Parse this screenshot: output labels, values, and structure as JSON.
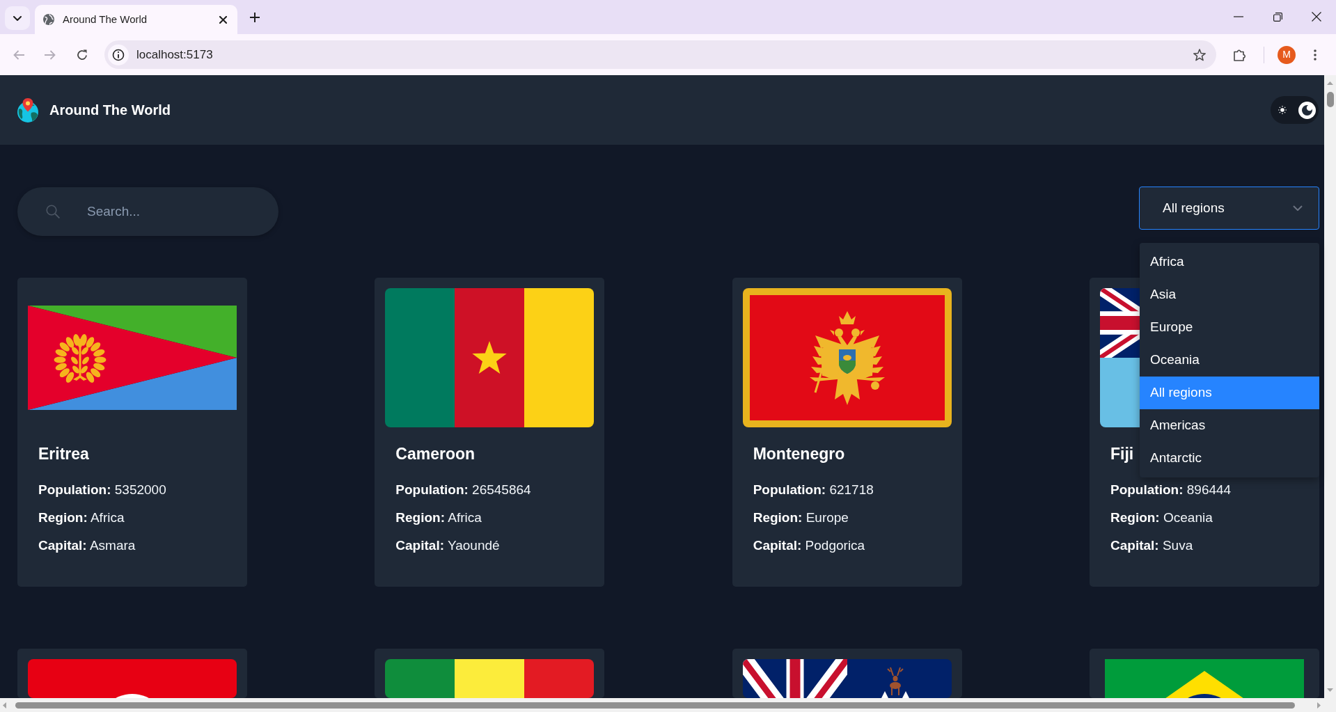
{
  "browser": {
    "tab_title": "Around The World",
    "url": "localhost:5173",
    "back": {
      "disabled": true
    },
    "forward": {
      "disabled": true
    },
    "profile_initial": "M"
  },
  "header": {
    "title": "Around The World",
    "theme_toggle": {
      "dark": true
    }
  },
  "search": {
    "placeholder": "Search..."
  },
  "region_filter": {
    "value": "All regions",
    "expanded": true,
    "options": [
      {
        "label": "Africa",
        "selected": false
      },
      {
        "label": "Asia",
        "selected": false
      },
      {
        "label": "Europe",
        "selected": false
      },
      {
        "label": "Oceania",
        "selected": false
      },
      {
        "label": "All regions",
        "selected": true
      },
      {
        "label": "Americas",
        "selected": false
      },
      {
        "label": "Antarctic",
        "selected": false
      }
    ]
  },
  "countries": [
    {
      "kind": "eritrea",
      "name": "Eritrea",
      "details": [
        "**Population:** 5352000",
        "**Region:** Africa",
        "**Capital:** Asmara"
      ]
    },
    {
      "kind": "cameroon",
      "name": "Cameroon",
      "details": [
        "**Population:** 26545864",
        "**Region:** Africa",
        "**Capital:** Yaoundé"
      ]
    },
    {
      "kind": "montenegro",
      "name": "Montenegro",
      "details": [
        "**Population:** 621718",
        "**Region:** Europe",
        "**Capital:** Podgorica"
      ]
    },
    {
      "kind": "fiji",
      "name": "Fiji",
      "details": [
        "**Population:** 896444",
        "**Region:** Oceania",
        "**Capital:** Suva"
      ]
    },
    {
      "kind": "tunisia"
    },
    {
      "kind": "mali"
    },
    {
      "kind": "southgeorgia"
    },
    {
      "kind": "brazil"
    }
  ]
}
